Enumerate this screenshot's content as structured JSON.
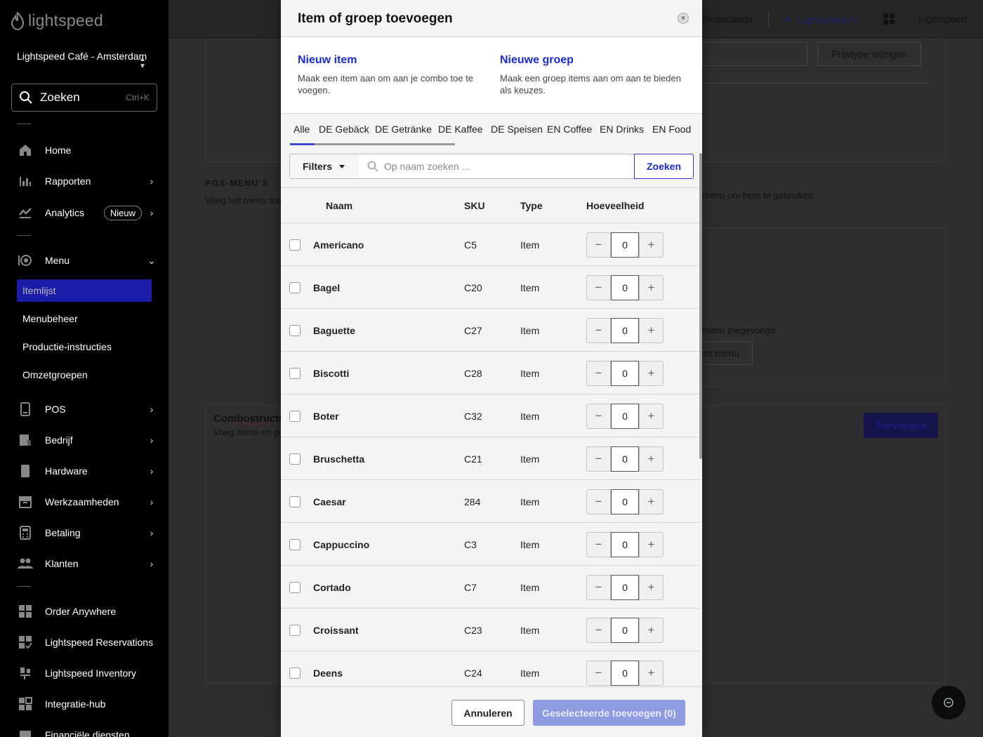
{
  "sidebar": {
    "logo_text": "lightspeed",
    "store_name": "Lightspeed Café - Amsterdam",
    "search": {
      "label": "Zoeken",
      "shortcut": "Ctrl+K"
    },
    "nav": [
      {
        "label": "Home",
        "icon": "home-icon"
      },
      {
        "label": "Rapporten",
        "icon": "bar-chart-icon"
      },
      {
        "label": "Analytics",
        "icon": "analytics-icon",
        "badge": "Nieuw"
      },
      {
        "label": "Menu",
        "icon": "menu-icon"
      },
      {
        "label": "POS",
        "icon": "pos-icon"
      },
      {
        "label": "Bedrijf",
        "icon": "business-icon"
      },
      {
        "label": "Hardware",
        "icon": "hardware-icon"
      },
      {
        "label": "Werkzaamheden",
        "icon": "operations-icon"
      },
      {
        "label": "Betaling",
        "icon": "payment-icon"
      },
      {
        "label": "Klanten",
        "icon": "customers-icon"
      }
    ],
    "menu_sub": [
      {
        "label": "Itemlijst",
        "active": true
      },
      {
        "label": "Menubeheer"
      },
      {
        "label": "Productie-instructies"
      },
      {
        "label": "Omzetgroepen"
      }
    ],
    "apps": [
      {
        "label": "Order Anywhere",
        "icon": "order-anywhere-icon"
      },
      {
        "label": "Lightspeed Reservations",
        "icon": "reservations-icon"
      },
      {
        "label": "Lightspeed Inventory",
        "icon": "inventory-icon"
      },
      {
        "label": "Integratie-hub",
        "icon": "integration-hub-icon"
      },
      {
        "label": "Financiële diensten",
        "icon": "financial-services-icon"
      }
    ]
  },
  "topbar": {
    "language": "Nederlands",
    "ai_label": "Lightspeed AI",
    "user_label": "Lightspeed"
  },
  "background": {
    "price_type_button": "Prijstype wijzigen",
    "pos_heading": "POS-MENU'S",
    "pos_text": "Voeg het menu toe op je POS verschillende",
    "pos_right_text": "menu om hem te gebruiken.",
    "added_text": "menu toegevoegd.",
    "menu_button": "en menu",
    "combo_title": "Combostructuur",
    "combo_subtitle": "Voeg items en groepen toe",
    "add_button": "Toevoegen"
  },
  "modal": {
    "title": "Item of groep toevoegen",
    "options": [
      {
        "title": "Nieuw item",
        "desc": "Maak een item aan om aan je combo toe te voegen."
      },
      {
        "title": "Nieuwe groep",
        "desc": "Maak een groep items aan om aan te bieden als keuzes."
      }
    ],
    "tabs": [
      "Alle",
      "DE Gebäck",
      "DE Getränke",
      "DE Kaffee",
      "DE Speisen",
      "EN Coffee",
      "EN Drinks",
      "EN Food"
    ],
    "filters_label": "Filters",
    "search_placeholder": "Op naam zoeken ...",
    "search_button": "Zoeken",
    "columns": {
      "name": "Naam",
      "sku": "SKU",
      "type": "Type",
      "quantity": "Hoeveelheid"
    },
    "rows": [
      {
        "name": "Americano",
        "sku": "C5",
        "type": "Item",
        "qty": "0"
      },
      {
        "name": "Bagel",
        "sku": "C20",
        "type": "Item",
        "qty": "0"
      },
      {
        "name": "Baguette",
        "sku": "C27",
        "type": "Item",
        "qty": "0"
      },
      {
        "name": "Biscotti",
        "sku": "C28",
        "type": "Item",
        "qty": "0"
      },
      {
        "name": "Boter",
        "sku": "C32",
        "type": "Item",
        "qty": "0"
      },
      {
        "name": "Bruschetta",
        "sku": "C21",
        "type": "Item",
        "qty": "0"
      },
      {
        "name": "Caesar",
        "sku": "284",
        "type": "Item",
        "qty": "0"
      },
      {
        "name": "Cappuccino",
        "sku": "C3",
        "type": "Item",
        "qty": "0"
      },
      {
        "name": "Cortado",
        "sku": "C7",
        "type": "Item",
        "qty": "0"
      },
      {
        "name": "Croissant",
        "sku": "C23",
        "type": "Item",
        "qty": "0"
      },
      {
        "name": "Deens",
        "sku": "C24",
        "type": "Item",
        "qty": "0"
      }
    ],
    "cancel_button": "Annuleren",
    "submit_button": "Geselecteerde toevoegen (0)"
  },
  "colors": {
    "accent": "#1a2ad6",
    "active_nav": "#1c1ca8",
    "submit_disabled": "#8f9be0"
  }
}
